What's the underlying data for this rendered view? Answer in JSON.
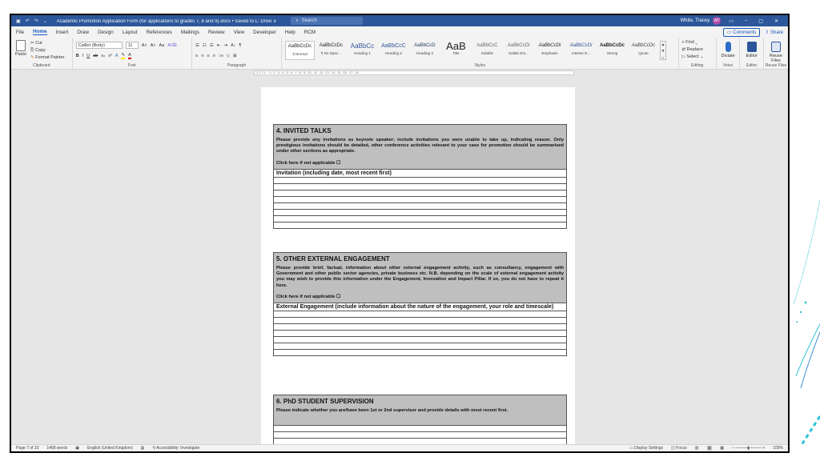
{
  "titlebar": {
    "doc_title": "Academic Promotion Application Form (for applications to grades 7, 8 and 9).docx • Saved to L: Drive ∨",
    "search": "Search",
    "user": "White, Tracey",
    "avatar_initials": "WT"
  },
  "menu": {
    "tabs": [
      "File",
      "Home",
      "Insert",
      "Draw",
      "Design",
      "Layout",
      "References",
      "Mailings",
      "Review",
      "View",
      "Developer",
      "Help",
      "RCM"
    ],
    "active_tab": "Home",
    "comments": "Comments",
    "share": "Share"
  },
  "ribbon": {
    "clipboard": {
      "paste": "Paste",
      "cut": "Cut",
      "copy": "Copy",
      "format_painter": "Format Painter",
      "label": "Clipboard"
    },
    "font": {
      "name": "Calibri (Body)",
      "size": "11",
      "label": "Font"
    },
    "paragraph": {
      "label": "Paragraph"
    },
    "styles": {
      "label": "Styles",
      "items": [
        {
          "preview": "AaBbCcDc",
          "name": "¶ Normal"
        },
        {
          "preview": "AaBbCcDc",
          "name": "¶ No Spac..."
        },
        {
          "preview": "AaBbCc",
          "name": "Heading 1"
        },
        {
          "preview": "AaBbCcC",
          "name": "Heading 2"
        },
        {
          "preview": "AaBbCcD",
          "name": "Heading 3"
        },
        {
          "preview": "AaB",
          "name": "Title"
        },
        {
          "preview": "AaBbCcC",
          "name": "Subtitle"
        },
        {
          "preview": "AaBbCcDi",
          "name": "Subtle Em..."
        },
        {
          "preview": "AaBbCcDi",
          "name": "Emphasis"
        },
        {
          "preview": "AaBbCcDi",
          "name": "Intense E..."
        },
        {
          "preview": "AaBbCcDc",
          "name": "Strong"
        },
        {
          "preview": "AaBbCcDc",
          "name": "Quote"
        }
      ]
    },
    "editing": {
      "find": "Find",
      "replace": "Replace",
      "select": "Select",
      "label": "Editing"
    },
    "voice": {
      "dictate": "Dictate",
      "label": "Voice"
    },
    "editor": {
      "editor": "Editor",
      "label": "Editor"
    },
    "reuse": {
      "reuse": "Reuse Files",
      "label": "Reuse Files"
    }
  },
  "document": {
    "section4": {
      "heading": "4. INVITED TALKS",
      "para": "Please provide any invitations as keynote speaker; include invitations you were unable to take up, indicating reason.  Only prestigious invitations should be detailed, other conference activities relevant to your case for promotion should be summarised under other sections as appropriate.",
      "checkbox": "Click here if not applicable ☐",
      "column": "Invitation (including date, most recent first)"
    },
    "section5": {
      "heading": "5. OTHER EXTERNAL ENGAGEMENT",
      "para": "Please provide brief, factual, information about other external engagement activity, such as consultancy, engagement with Government and other public sector agencies, private business etc.  N.B. depending on the scale of external engagement activity you may wish to provide this information under the Engagement, Innovation and Impact Pillar. If so, you do not have to repeat it here.",
      "checkbox": "Click here if not applicable ☐",
      "column": "External Engagement (include information about the nature of the engagement, your role and timescale)"
    },
    "section6": {
      "heading": "6. PhD STUDENT SUPERVISION",
      "para": "Please indicate whether you are/have been 1st or 2nd supervisor and provide details with most recent first."
    }
  },
  "status": {
    "page": "Page 7 of 10",
    "words": "1468 words",
    "language": "English (United Kingdom)",
    "accessibility": "Accessibility: Investigate",
    "display_settings": "Display Settings",
    "focus": "Focus",
    "zoom": "100%"
  },
  "colors": {
    "accent": "#2b579a",
    "section_header": "#bfbfbf"
  }
}
